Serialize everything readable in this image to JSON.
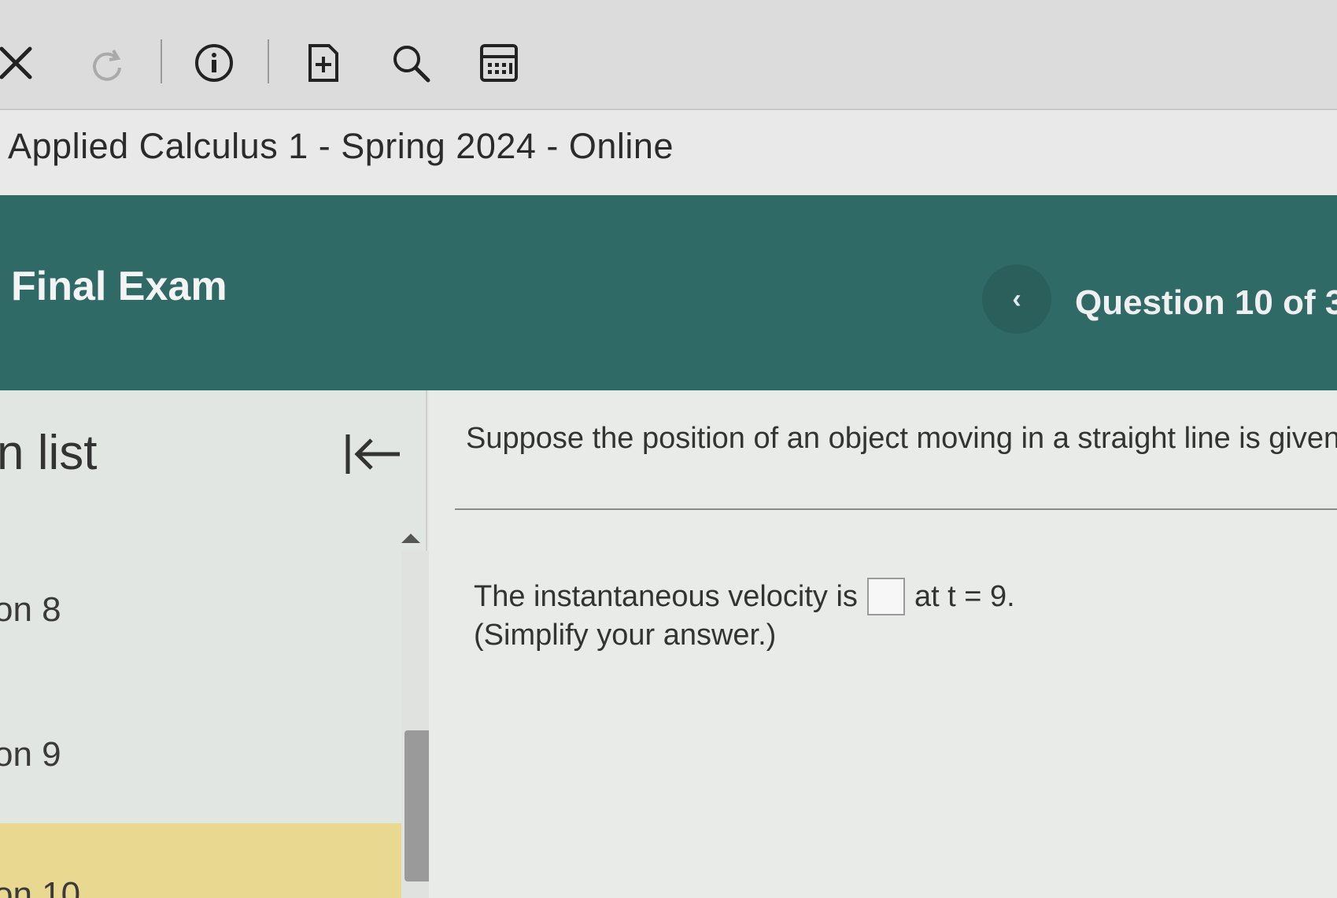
{
  "toolbar": {
    "icons": [
      "close-icon",
      "redo-icon",
      "info-icon",
      "add-note-icon",
      "search-icon",
      "calculator-icon"
    ]
  },
  "course": {
    "title": "Applied Calculus 1 - Spring 2024 - Online"
  },
  "exam": {
    "title": "Final Exam",
    "prev_label": "‹",
    "question_counter": "Question 10 of 3"
  },
  "question_list": {
    "title": "n list",
    "collapse_label": "|←",
    "items": [
      {
        "label": "on 8"
      },
      {
        "label": "on 9"
      },
      {
        "label": "on 10"
      }
    ]
  },
  "question": {
    "prompt": "Suppose the position of an object moving in a straight line is given",
    "answer_prefix": "The instantaneous velocity is",
    "answer_suffix": "at t = 9.",
    "answer_value": "",
    "hint": "(Simplify your answer.)"
  },
  "colors": {
    "header": "#2f6a67",
    "highlight": "#e8d890",
    "accent_blue": "#6b9bd1"
  }
}
